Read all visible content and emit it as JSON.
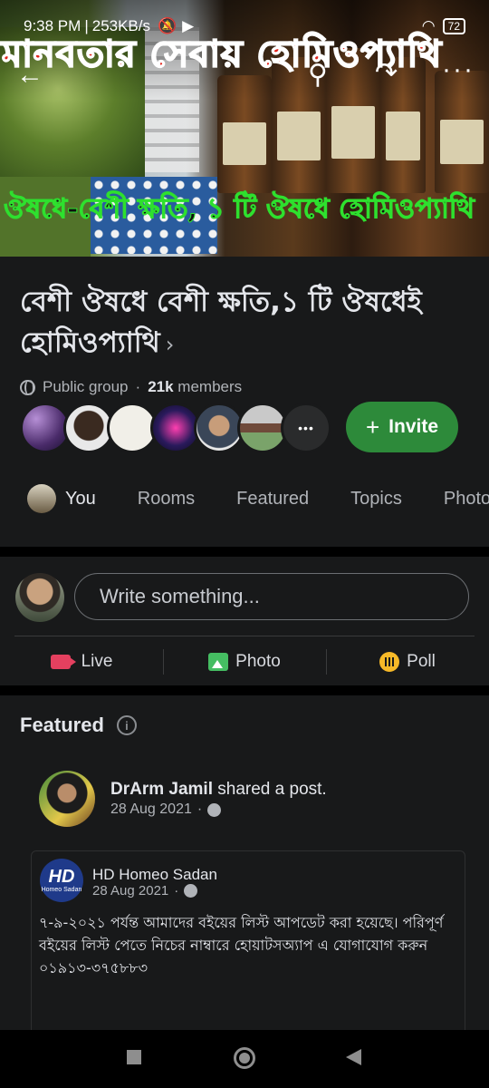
{
  "status_bar": {
    "time": "9:38 PM",
    "speed": "253KB/s",
    "battery": "72"
  },
  "cover": {
    "title_top": "মানবতার সেবায় হোমিওপ্যাথি",
    "title_bottom": "ঔষধে-বেশী ক্ষতি, ১ টি ঔষধে হোমিওপ্যাথি"
  },
  "top_bar": {
    "back_icon": "arrow-left-icon",
    "search_icon": "search-icon",
    "share_icon": "share-icon",
    "more_icon": "more-icon"
  },
  "group": {
    "title": "বেশী ঔষধে বেশী ক্ষতি,১ টি ঔষধেই হোমিওপ্যাথি",
    "chevron": "›",
    "privacy": "Public group",
    "separator": "·",
    "member_count": "21k",
    "member_label": "members",
    "invite_label": "Invite",
    "more_members": "•••"
  },
  "tabs": [
    {
      "label": "You"
    },
    {
      "label": "Rooms"
    },
    {
      "label": "Featured"
    },
    {
      "label": "Topics"
    },
    {
      "label": "Photo"
    }
  ],
  "composer": {
    "placeholder": "Write something...",
    "actions": [
      {
        "label": "Live"
      },
      {
        "label": "Photo"
      },
      {
        "label": "Poll"
      }
    ]
  },
  "featured": {
    "heading": "Featured",
    "info_icon": "i",
    "post": {
      "author": "DrArm Jamil",
      "action": "shared a post.",
      "date": "28 Aug 2021",
      "dot": "·",
      "shared": {
        "page_name": "HD Homeo Sadan",
        "logo_main": "HD",
        "logo_sub": "Homeo Sadan",
        "date": "28 Aug 2021",
        "dot": "·",
        "text": "৭-৯-২০২১ পর্যন্ত আমাদের বইয়ের লিস্ট আপডেট করা হয়েছে। পরিপূর্ণ বইয়ের লিস্ট পেতে নিচের নাম্বারে হোয়াটসঅ্যাপ এ যোগাযোগ করুন ০১৯১৩-৩৭৫৮৮৩"
      }
    }
  },
  "colors": {
    "background": "#18191a",
    "invite": "#2d8a3a",
    "live": "#e4405f",
    "photo": "#45bd62",
    "poll": "#f7b928"
  }
}
